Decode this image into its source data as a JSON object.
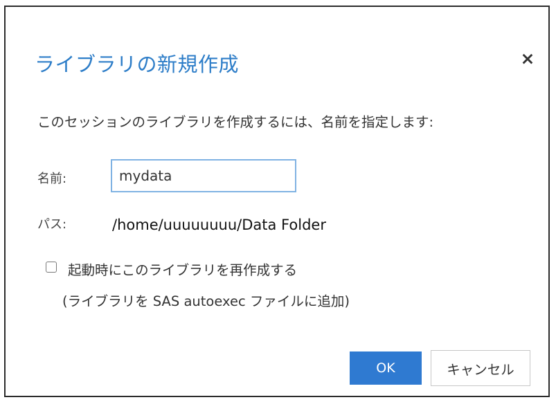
{
  "dialog": {
    "title": "ライブラリの新規作成",
    "close_icon": "×",
    "instruction": "このセッションのライブラリを作成するには、名前を指定します:",
    "name": {
      "label": "名前:",
      "value": "mydata",
      "placeholder": ""
    },
    "path": {
      "label": "パス:",
      "value": "/home/uuuuuuuu/Data Folder"
    },
    "recreate_option": {
      "checked": false,
      "label": "起動時にこのライブラリを再作成する",
      "note": "(ライブラリを SAS autoexec ファイルに追加)"
    },
    "buttons": {
      "ok_label": "OK",
      "cancel_label": "キャンセル"
    }
  },
  "colors": {
    "title": "#2d7dc8",
    "ok_button": "#2f7ad1",
    "input_border": "#7fb2e3"
  }
}
